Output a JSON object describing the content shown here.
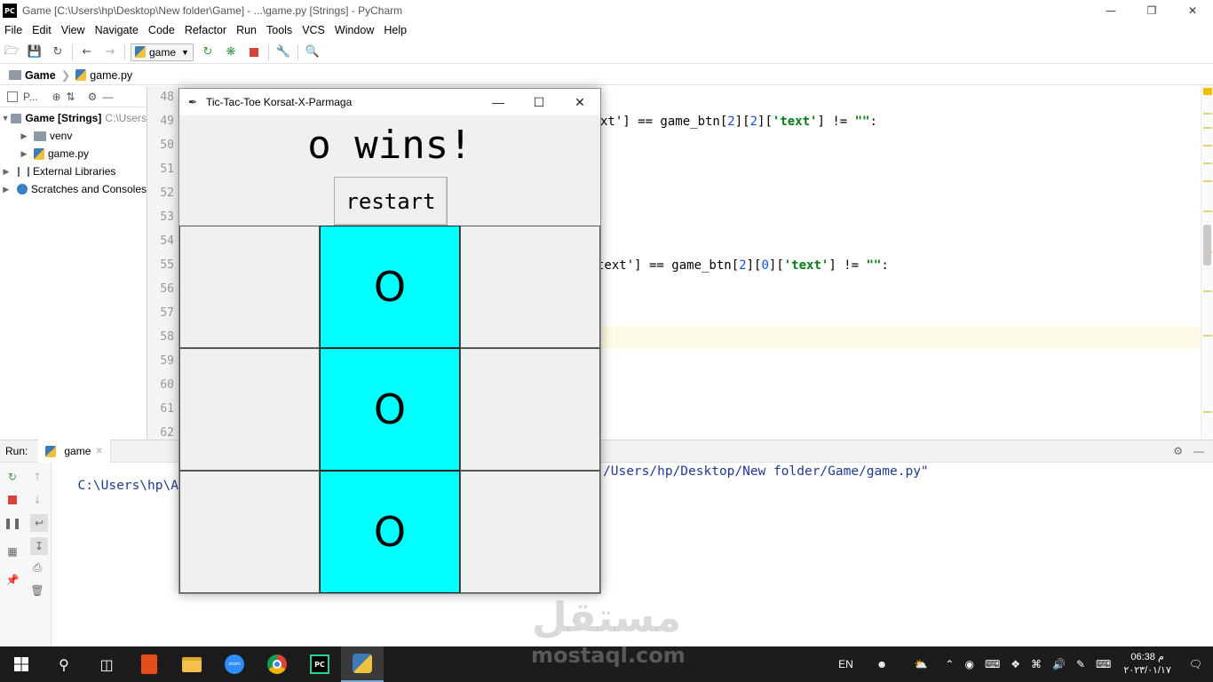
{
  "window": {
    "title": "Game [C:\\Users\\hp\\Desktop\\New folder\\Game] - ...\\game.py [Strings] - PyCharm",
    "logo": "PC",
    "controls": [
      "—",
      "❐",
      "✕"
    ]
  },
  "menu": [
    "File",
    "Edit",
    "View",
    "Navigate",
    "Code",
    "Refactor",
    "Run",
    "Tools",
    "VCS",
    "Window",
    "Help"
  ],
  "toolbar": {
    "run_config": "game",
    "icons": [
      "open-folder-icon",
      "save-icon",
      "sync-icon",
      "back-icon",
      "forward-icon",
      "run-icon",
      "debug-icon",
      "stop-icon",
      "wrench-icon",
      "search-icon"
    ]
  },
  "breadcrumbs": [
    "Game",
    "game.py"
  ],
  "project_panel": {
    "label": "P...",
    "tree": [
      {
        "label": "Game [Strings]",
        "path": "C:\\Users"
      },
      {
        "label": "venv"
      },
      {
        "label": "game.py"
      },
      {
        "label": "External Libraries"
      },
      {
        "label": "Scratches and Consoles"
      }
    ]
  },
  "editor": {
    "line_numbers": [
      "48",
      "49",
      "50",
      "51",
      "52",
      "53",
      "54",
      "55",
      "56",
      "57",
      "58",
      "59",
      "60",
      "61",
      "62"
    ],
    "code_line_49": {
      "pre": "xt'] == game_btn[",
      "n1": "2",
      "mid": "][",
      "n2": "2",
      "post": "][",
      "s1": "'text'",
      "end": "] != ",
      "s2": "\"\"",
      "colon": ":"
    },
    "code_line_55": {
      "pre": "text'] == game_btn[",
      "n1": "2",
      "mid": "][",
      "n2": "0",
      "post": "][",
      "s1": "'text'",
      "end": "] != ",
      "s2": "\"\"",
      "colon": ":"
    }
  },
  "run_panel": {
    "label": "Run:",
    "tab": "game",
    "output_left": "C:\\Users\\hp\\App",
    "output_right": "/Users/hp/Desktop/New folder/Game/game.py\""
  },
  "tk_window": {
    "title": "Tic-Tac-Toe Korsat-X-Parmaga",
    "message": "o wins!",
    "restart_label": "restart",
    "cells": [
      "",
      "O",
      "",
      "",
      "O",
      "",
      "",
      "O",
      ""
    ],
    "winning_cells": [
      1,
      4,
      7
    ],
    "win_color": "#00ffff"
  },
  "watermark": {
    "arabic": "مستقل",
    "latin": "mostaql.com"
  },
  "taskbar": {
    "language": "EN",
    "time": "06:38 م",
    "date": "٢٠٢٣/٠١/١٧"
  }
}
